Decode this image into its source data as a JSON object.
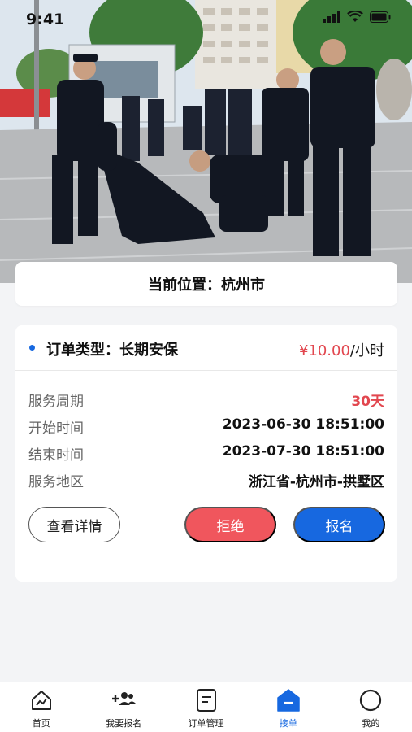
{
  "status_bar": {
    "time": "9:41"
  },
  "hero": {
    "description_icon": "security-guards-photo"
  },
  "location": {
    "label": "当前位置：杭州市"
  },
  "order": {
    "type_label": "订单类型：长期安保",
    "price_amount": "¥10.00",
    "price_unit": "/小时",
    "rows": [
      {
        "key": "服务周期",
        "value": "30天"
      },
      {
        "key": "开始时间",
        "value": "2023-06-30 18:51:00"
      },
      {
        "key": "结束时间",
        "value": "2023-07-30 18:51:00"
      },
      {
        "key": "服务地区",
        "value": "浙江省-杭州市-拱墅区"
      }
    ],
    "buttons": {
      "detail": "查看详情",
      "reject": "拒绝",
      "apply": "报名"
    },
    "accent_red": "#e2474f",
    "accent_blue": "#1768e0"
  },
  "tabbar": {
    "items": [
      {
        "label": "首页",
        "icon": "home-chart-icon"
      },
      {
        "label": "我要报名",
        "icon": "add-user-icon"
      },
      {
        "label": "订单管理",
        "icon": "order-document-icon"
      },
      {
        "label": "接单",
        "icon": "take-order-icon",
        "active": true
      },
      {
        "label": "我的",
        "icon": "profile-circle-icon"
      }
    ]
  }
}
